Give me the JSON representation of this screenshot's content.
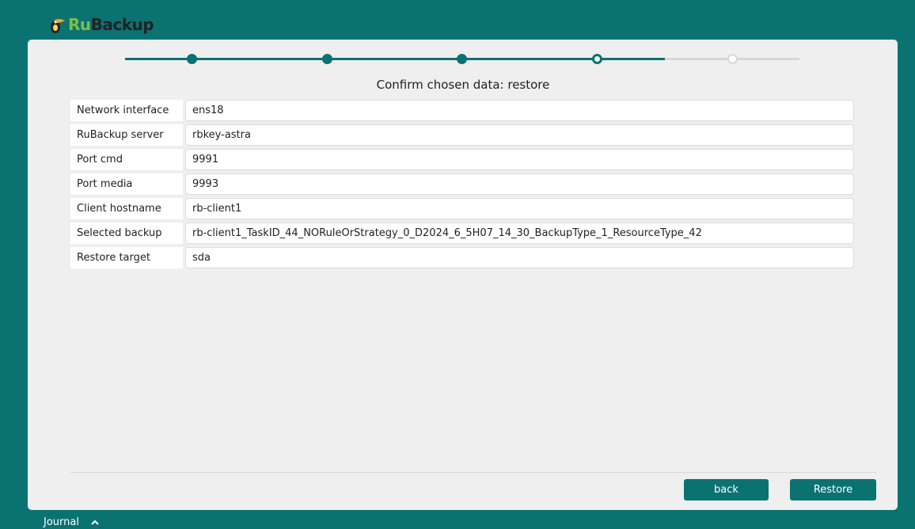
{
  "app": {
    "logo_ru": "Ru",
    "logo_backup": "Backup"
  },
  "stepper": {
    "total_steps": 5,
    "completed": 3,
    "current": 4
  },
  "heading": "Confirm chosen data: restore",
  "rows": [
    {
      "label": "Network interface",
      "value": "ens18"
    },
    {
      "label": "RuBackup server",
      "value": "rbkey-astra"
    },
    {
      "label": "Port cmd",
      "value": "9991"
    },
    {
      "label": "Port media",
      "value": "9993"
    },
    {
      "label": "Client hostname",
      "value": "rb-client1"
    },
    {
      "label": "Selected backup",
      "value": "rb-client1_TaskID_44_NORuleOrStrategy_0_D2024_6_5H07_14_30_BackupType_1_ResourceType_42"
    },
    {
      "label": "Restore target",
      "value": "sda"
    }
  ],
  "buttons": {
    "back": "back",
    "restore": "Restore"
  },
  "footer": {
    "journal": "Journal",
    "journal_icon": "chevron-up-icon"
  },
  "colors": {
    "accent": "#0b7272",
    "panel": "#efefef",
    "inactive": "#d7d7d7"
  }
}
